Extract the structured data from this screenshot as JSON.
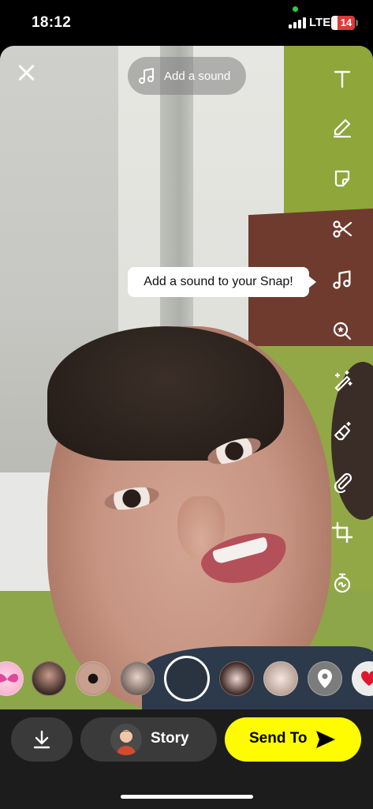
{
  "status_bar": {
    "time": "18:12",
    "network": "LTE",
    "battery": "14"
  },
  "camera": {
    "add_sound_label": "Add a sound",
    "tooltip": "Add a sound to your Snap!"
  },
  "toolbar": {
    "tools": [
      "text-tool",
      "pen-tool",
      "sticker-tool",
      "scissors-tool",
      "music-tool",
      "lens-search-tool",
      "magic-eraser-tool",
      "eraser-tool",
      "paperclip-tool",
      "crop-tool",
      "timer-tool"
    ]
  },
  "lenses": {
    "items": [
      "butterfly-lens",
      "glasses-face-lens",
      "eye-lens",
      "portrait-lens",
      "capture",
      "girl-lens",
      "blonde-lens",
      "location-lens",
      "heart-lens"
    ]
  },
  "bottom_bar": {
    "story_label": "Story",
    "send_label": "Send To"
  },
  "colors": {
    "send_button": "#fffc00",
    "battery_low": "#e03a3a"
  }
}
